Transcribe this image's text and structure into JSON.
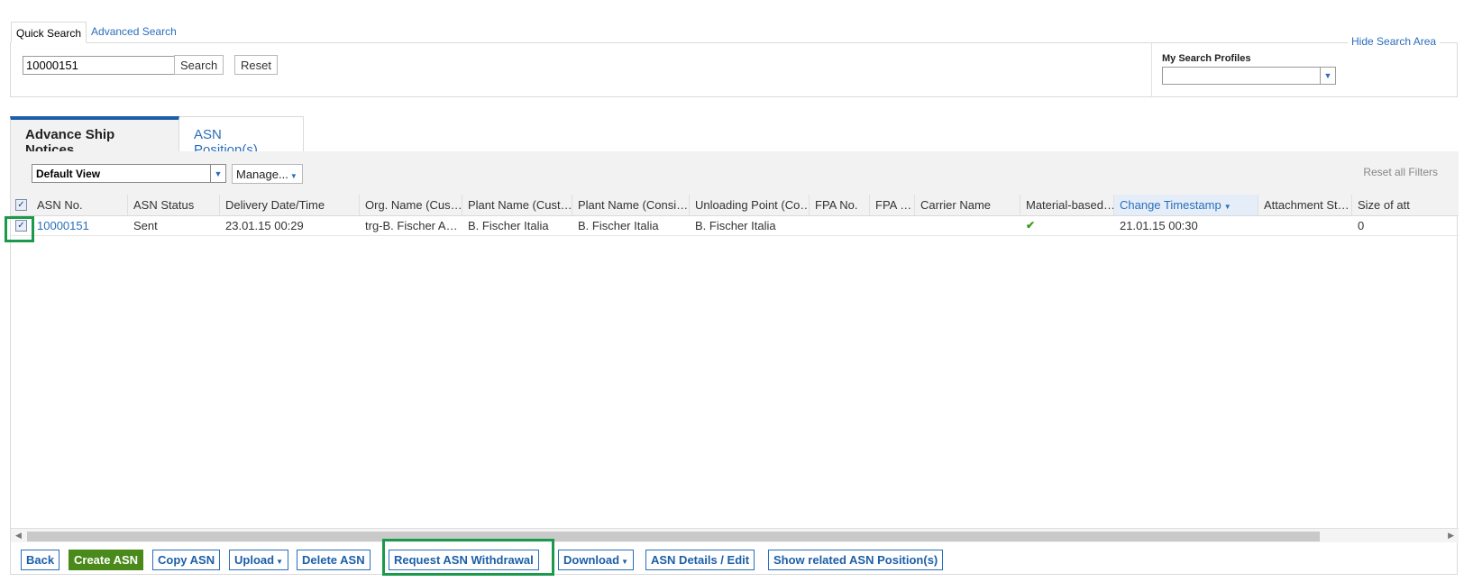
{
  "search": {
    "tab_quick": "Quick Search",
    "tab_advanced": "Advanced Search",
    "query_value": "10000151",
    "search_button": "Search",
    "reset_button": "Reset",
    "profiles_label": "My Search Profiles",
    "hide_link": "Hide Search Area"
  },
  "tabs": {
    "asn": "Advance Ship Notices",
    "positions": "ASN Position(s)"
  },
  "toolbar": {
    "view": "Default View",
    "manage": "Manage...",
    "reset_filters": "Reset all Filters"
  },
  "table": {
    "columns": [
      "ASN No.",
      "ASN Status",
      "Delivery Date/Time",
      "Org. Name (Cus…",
      "Plant Name (Cust…",
      "Plant Name (Consi…",
      "Unloading Point (Co…",
      "FPA No.",
      "FPA …",
      "Carrier Name",
      "Material-based…",
      "Change Timestamp",
      "Attachment St…",
      "Size of att"
    ],
    "rows": [
      {
        "asn_no": "10000151",
        "status": "Sent",
        "delivery": "23.01.15 00:29",
        "org_name": "trg-B. Fischer A…",
        "plant_cust": "B. Fischer Italia",
        "plant_consi": "B. Fischer Italia",
        "unloading": "B. Fischer Italia",
        "fpa_no": "",
        "fpa": "",
        "carrier": "",
        "material_based": "✔",
        "change_ts": "21.01.15 00:30",
        "attachment": "",
        "size": "0"
      }
    ]
  },
  "actions": {
    "back": "Back",
    "create": "Create ASN",
    "copy": "Copy ASN",
    "upload": "Upload",
    "delete": "Delete ASN",
    "withdraw": "Request ASN Withdrawal",
    "download": "Download",
    "details": "ASN Details / Edit",
    "related": "Show related ASN Position(s)"
  },
  "colors": {
    "link": "#2a6ebb",
    "primary_button": "#4a8a1a",
    "highlight": "#1a9a4a",
    "tab_accent": "#1c5fa8"
  }
}
